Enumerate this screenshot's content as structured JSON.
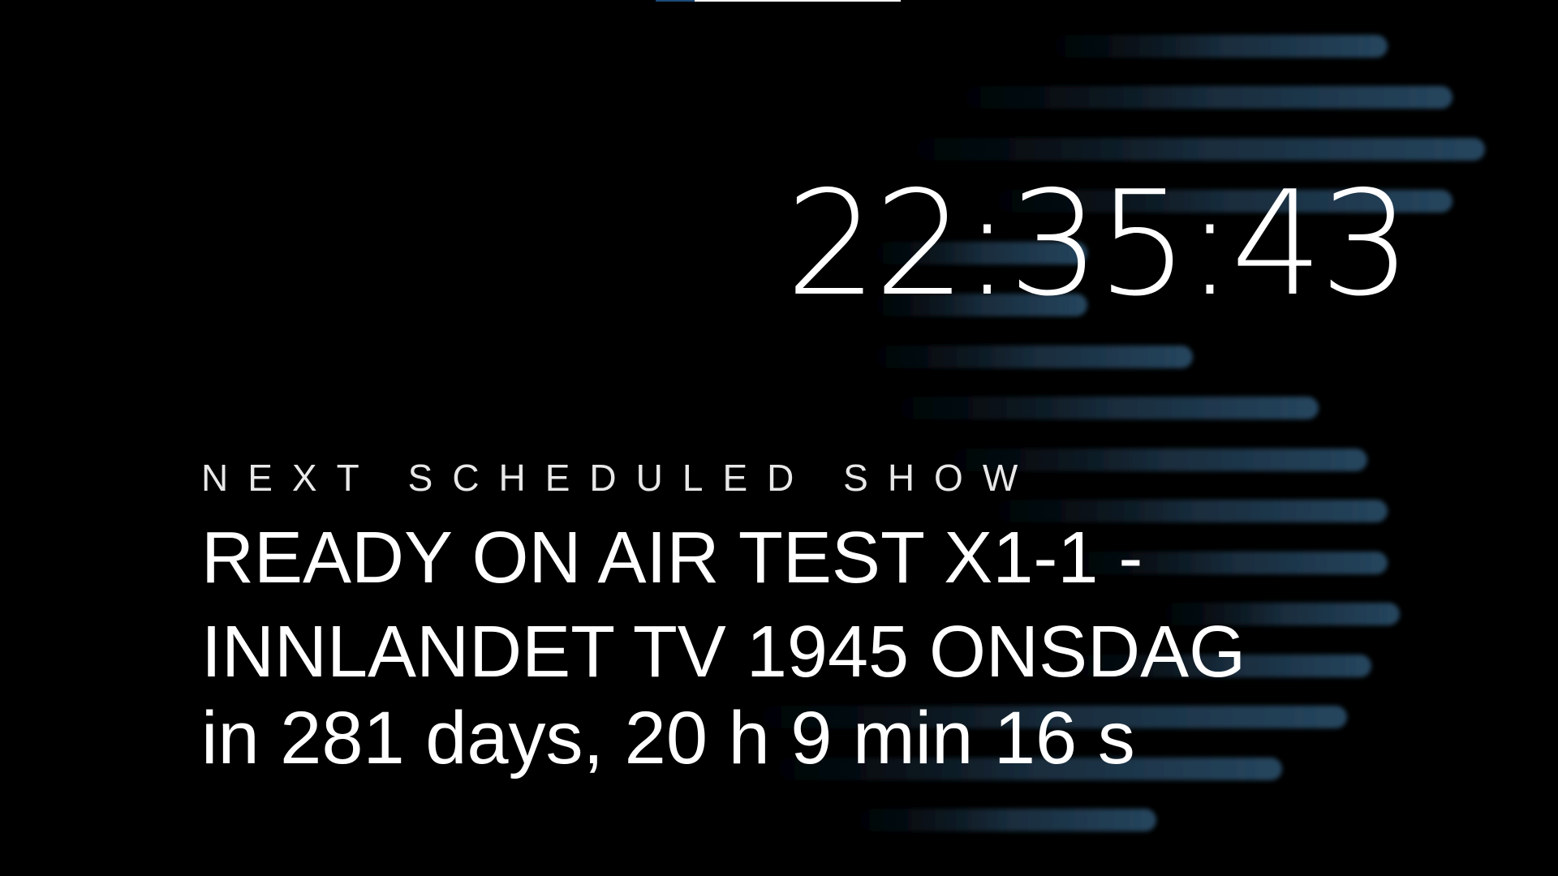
{
  "screen": {
    "background_color": "#000000",
    "accent_color": "#2a4a66"
  },
  "progress": {
    "fraction": 0.84
  },
  "clock": {
    "time": "22:35:43"
  },
  "next_show": {
    "label": "NEXT SCHEDULED SHOW",
    "title_line1": "READY ON AIR TEST X1-1 -",
    "title_line2": "INNLANDET TV 1945 ONSDAG",
    "countdown": "in 281 days, 20 h 9 min 16 s"
  }
}
